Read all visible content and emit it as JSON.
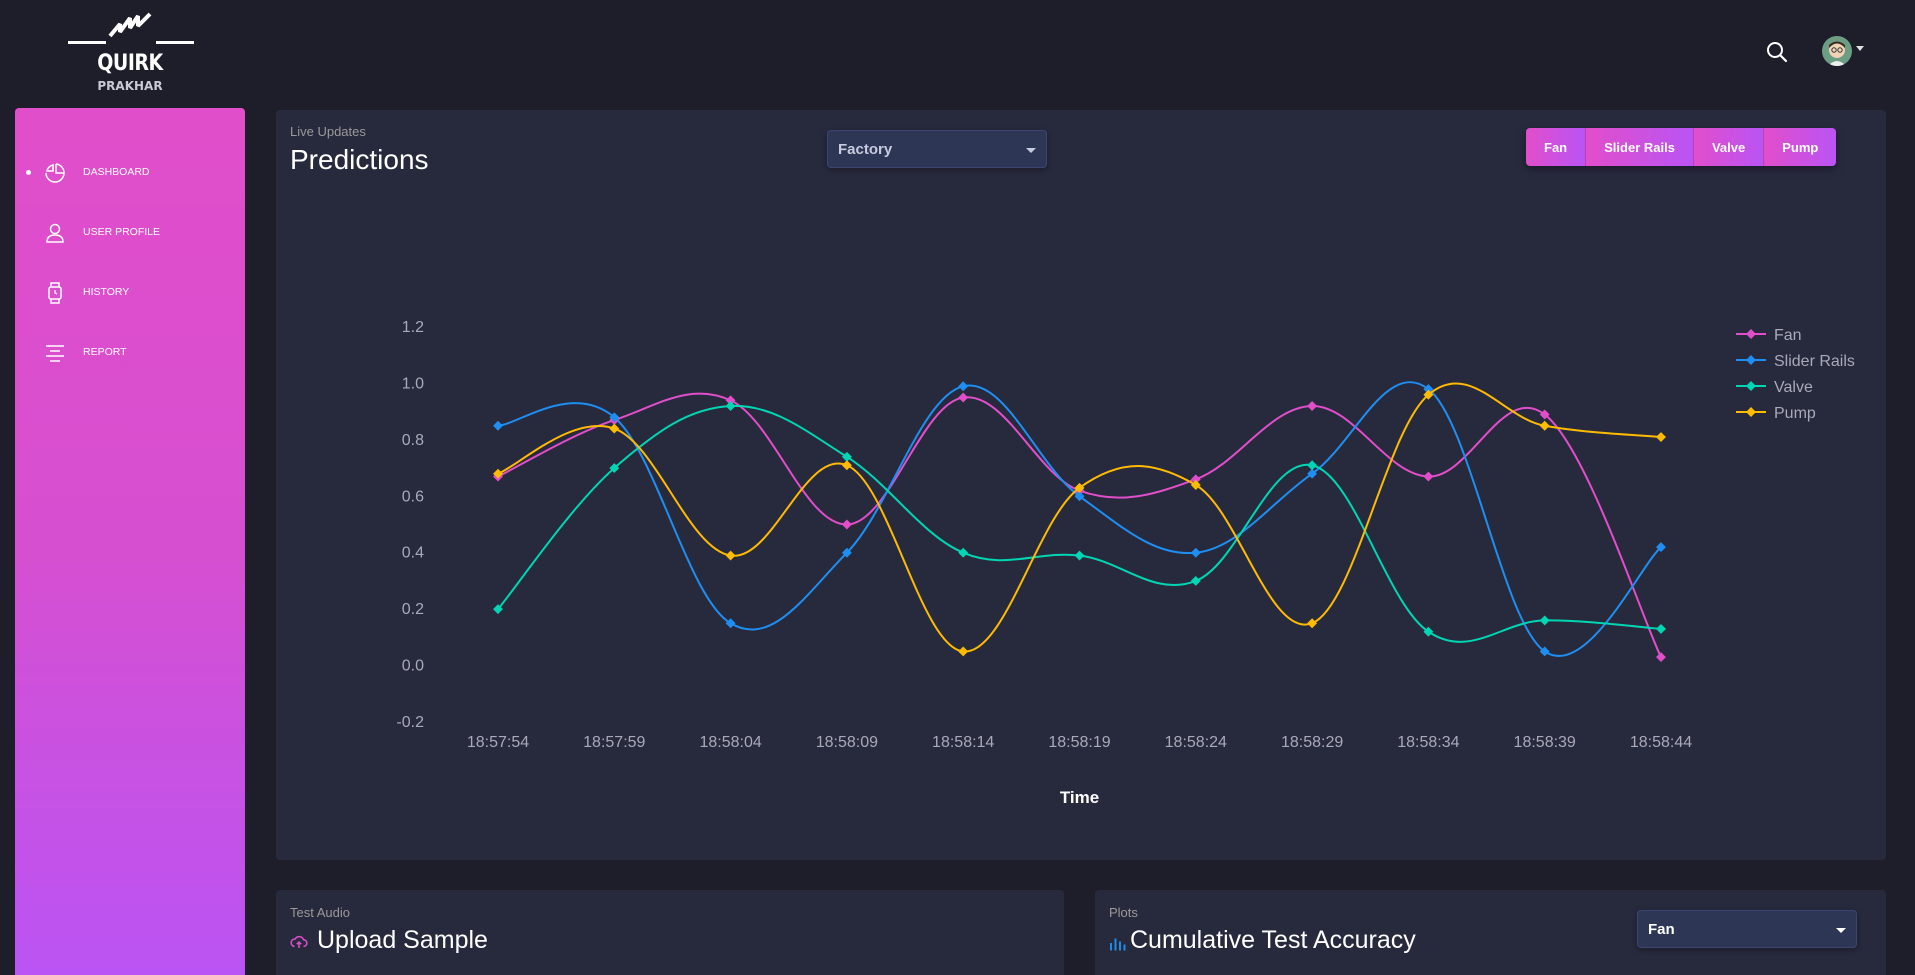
{
  "brand": {
    "name": "QUIRK",
    "user": "PRAKHAR"
  },
  "topbar": {
    "search_icon": "search-icon",
    "avatar": "user-avatar"
  },
  "sidebar": {
    "items": [
      {
        "label": "DASHBOARD",
        "icon": "pie-chart-icon",
        "active": true
      },
      {
        "label": "USER PROFILE",
        "icon": "user-icon",
        "active": false
      },
      {
        "label": "HISTORY",
        "icon": "watch-icon",
        "active": false
      },
      {
        "label": "REPORT",
        "icon": "align-center-icon",
        "active": false
      }
    ]
  },
  "main_card": {
    "category": "Live Updates",
    "title": "Predictions",
    "select_value": "Factory",
    "buttons": [
      "Fan",
      "Slider Rails",
      "Valve",
      "Pump"
    ]
  },
  "upload_card": {
    "category": "Test Audio",
    "title": "Upload Sample"
  },
  "accuracy_card": {
    "category": "Plots",
    "title": "Cumulative Test Accuracy",
    "select_value": "Fan"
  },
  "colors": {
    "fan": "#e14eca",
    "slider_rails": "#1f8ef1",
    "valve": "#00d6b4",
    "pump": "#ffbb00",
    "accent": "#e14eca"
  },
  "chart_data": {
    "type": "line",
    "xlabel": "Time",
    "ylabel": "",
    "ylim": [
      -0.2,
      1.2
    ],
    "yticks": [
      "1.2",
      "1.0",
      "0.8",
      "0.6",
      "0.4",
      "0.2",
      "0.0",
      "-0.2"
    ],
    "x": [
      "18:57:54",
      "18:57:59",
      "18:58:04",
      "18:58:09",
      "18:58:14",
      "18:58:19",
      "18:58:24",
      "18:58:29",
      "18:58:34",
      "18:58:39",
      "18:58:44"
    ],
    "legend_position": "right",
    "series": [
      {
        "name": "Fan",
        "color": "#e14eca",
        "values": [
          0.67,
          0.87,
          0.94,
          0.5,
          0.95,
          0.62,
          0.66,
          0.92,
          0.67,
          0.89,
          0.03
        ]
      },
      {
        "name": "Slider Rails",
        "color": "#1f8ef1",
        "values": [
          0.85,
          0.88,
          0.15,
          0.4,
          0.99,
          0.6,
          0.4,
          0.68,
          0.98,
          0.05,
          0.42
        ]
      },
      {
        "name": "Valve",
        "color": "#00d6b4",
        "values": [
          0.2,
          0.7,
          0.92,
          0.74,
          0.4,
          0.39,
          0.3,
          0.71,
          0.12,
          0.16,
          0.13
        ]
      },
      {
        "name": "Pump",
        "color": "#ffbb00",
        "values": [
          0.68,
          0.84,
          0.39,
          0.71,
          0.05,
          0.63,
          0.64,
          0.15,
          0.96,
          0.85,
          0.81
        ]
      }
    ]
  }
}
